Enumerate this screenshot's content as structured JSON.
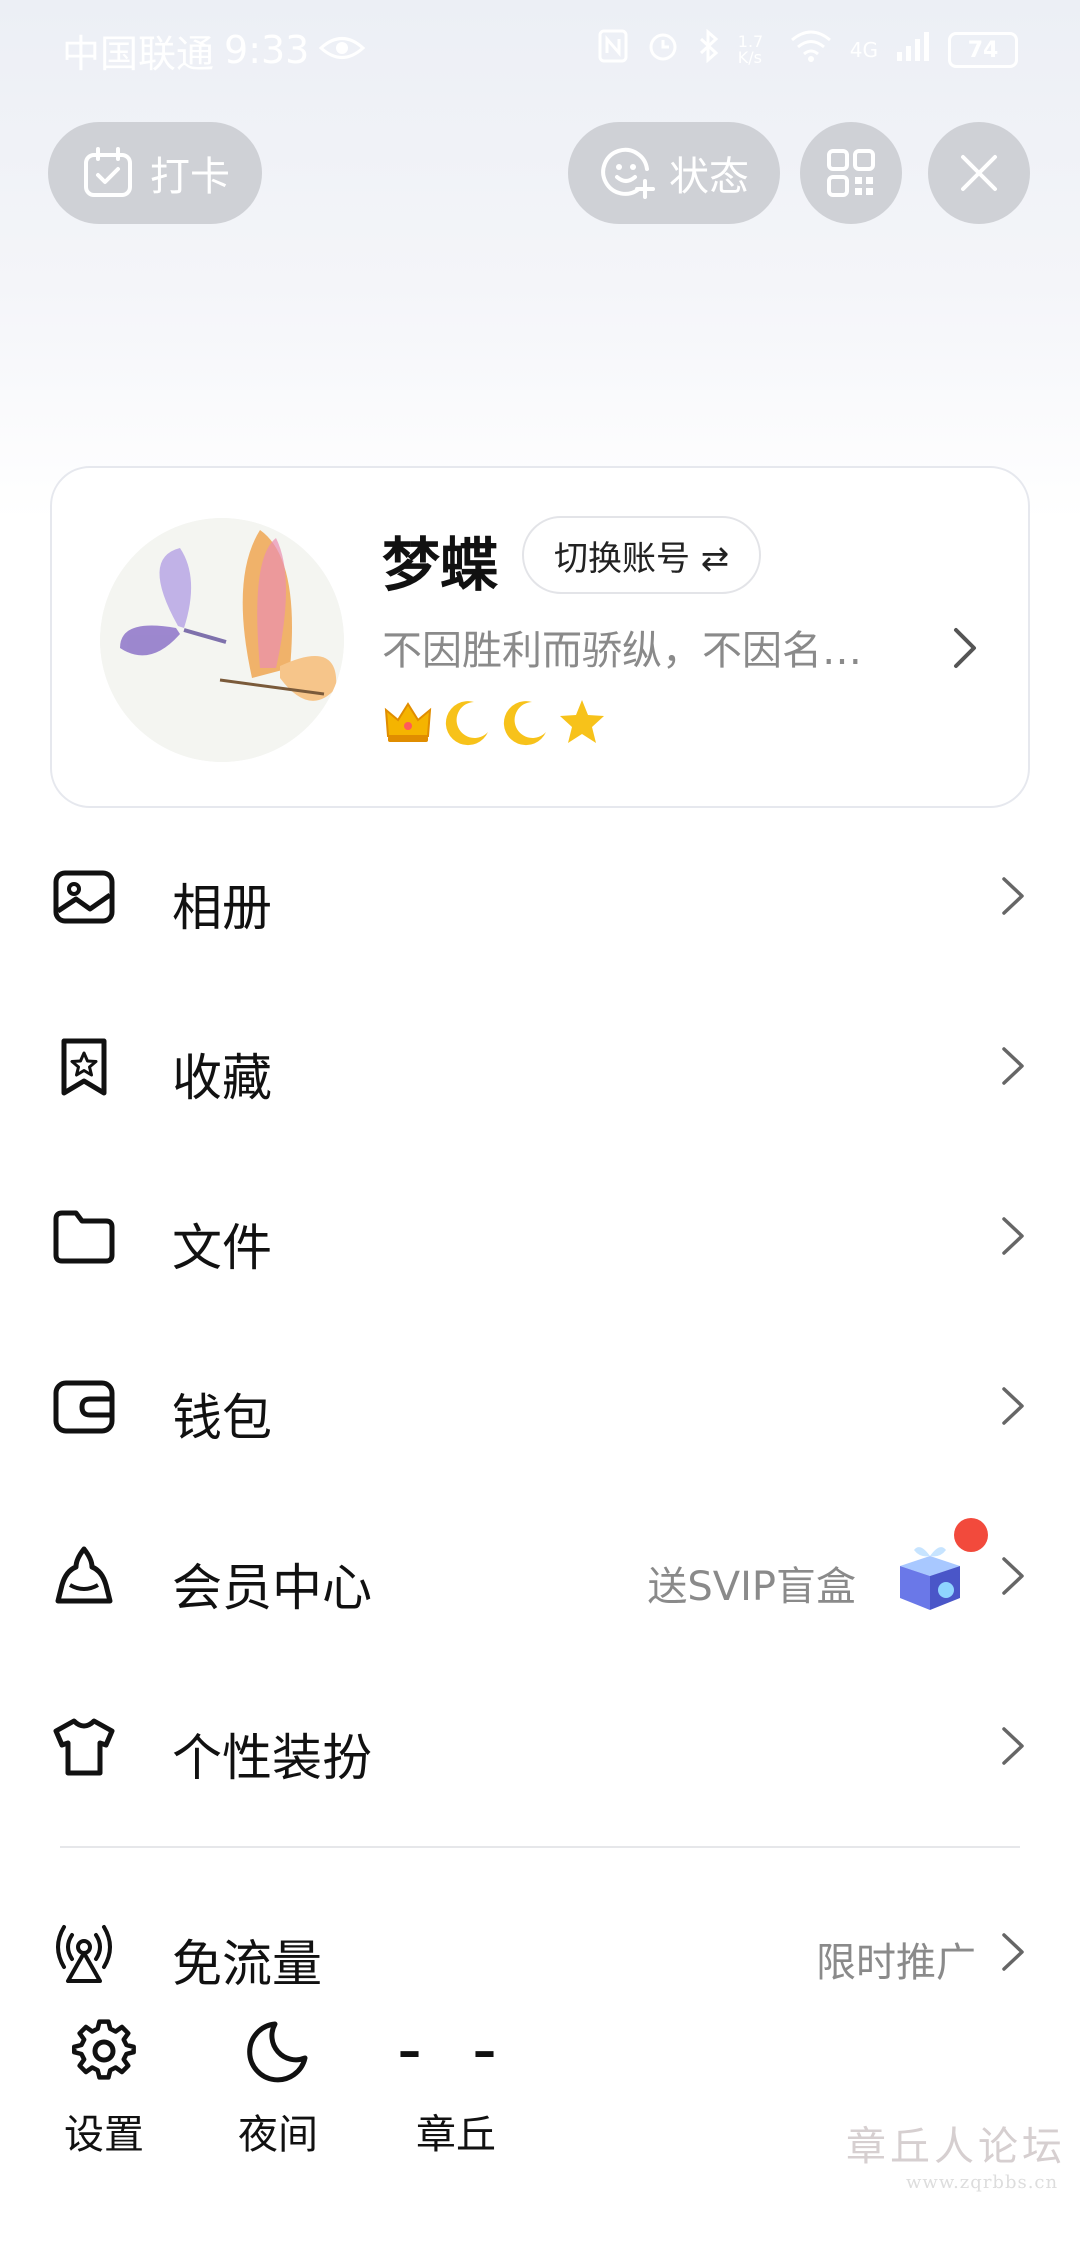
{
  "status_bar": {
    "carrier": "中国联通",
    "time": "9:33",
    "network_type": "4G",
    "speed": "1.7 K/s",
    "battery": "74",
    "icons": [
      "eye-icon",
      "nfc-icon",
      "alarm-icon",
      "bluetooth-icon",
      "wifi-icon",
      "signal-icon",
      "battery-icon"
    ]
  },
  "header": {
    "checkin_label": "打卡",
    "status_label": "状态"
  },
  "profile": {
    "nickname": "梦蝶",
    "switch_account_label": "切换账号 ⇄",
    "signature": "不因胜利而骄纵，不因名…",
    "badges": [
      "crown",
      "moon",
      "moon",
      "star"
    ]
  },
  "menu": [
    {
      "label": "相册",
      "icon": "album-icon"
    },
    {
      "label": "收藏",
      "icon": "favorites-icon"
    },
    {
      "label": "文件",
      "icon": "folder-icon"
    },
    {
      "label": "钱包",
      "icon": "wallet-icon"
    },
    {
      "label": "会员中心",
      "icon": "vip-icon",
      "extra": "送SVIP盲盒"
    },
    {
      "label": "个性装扮",
      "icon": "tshirt-icon"
    },
    {
      "label": "免流量",
      "icon": "signal-tower-icon",
      "extra": "限时推广"
    }
  ],
  "bottom_bar": {
    "settings_label": "设置",
    "night_label": "夜间",
    "weather_value": "– –",
    "city_label": "章丘"
  },
  "colors": {
    "pill_bg": "#cfd1d6",
    "red_dot": "#f24a3c",
    "secondary_text": "#8a8a8a"
  }
}
